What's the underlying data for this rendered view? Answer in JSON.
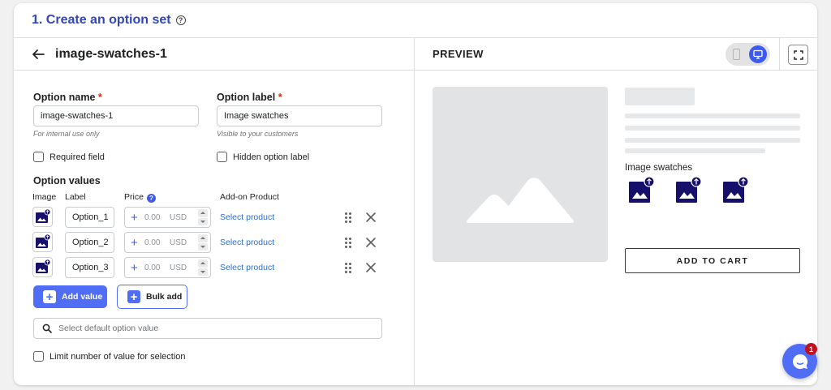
{
  "section": {
    "title": "1. Create an option set"
  },
  "editor": {
    "title": "image-swatches-1",
    "option_name_label": "Option name",
    "option_name_value": "image-swatches-1",
    "option_name_help": "For internal use only",
    "option_label_label": "Option label",
    "option_label_value": "Image swatches",
    "option_label_help": "Visible to your customers",
    "required_star": "*",
    "required_field_label": "Required field",
    "hidden_label_label": "Hidden option label",
    "option_values_label": "Option values",
    "columns": {
      "image": "Image",
      "label": "Label",
      "price": "Price",
      "addon": "Add-on Product"
    },
    "rows": [
      {
        "label": "Option_1",
        "price": "0.00",
        "currency": "USD",
        "product_link": "Select product"
      },
      {
        "label": "Option_2",
        "price": "0.00",
        "currency": "USD",
        "product_link": "Select product"
      },
      {
        "label": "Option_3",
        "price": "0.00",
        "currency": "USD",
        "product_link": "Select product"
      }
    ],
    "add_value_label": "Add value",
    "bulk_add_label": "Bulk add",
    "default_search_placeholder": "Select default option value",
    "limit_label": "Limit number of value for selection"
  },
  "preview": {
    "title": "PREVIEW",
    "option_label": "Image swatches",
    "add_to_cart": "ADD TO CART"
  },
  "chat": {
    "badge_count": "1"
  },
  "colors": {
    "accent": "#4f6ef5",
    "title_blue": "#3346b8",
    "swatch_navy": "#17106b",
    "required_red": "#d72c0d",
    "link_blue": "#2c6ecb"
  }
}
